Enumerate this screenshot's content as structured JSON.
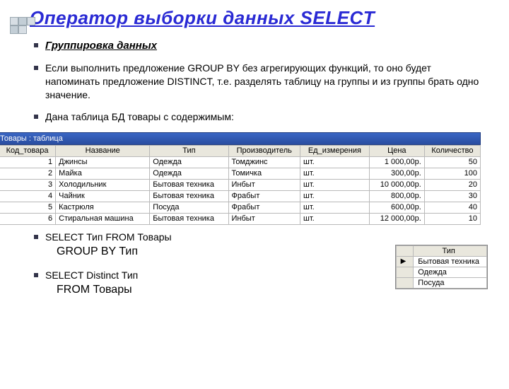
{
  "title": "Оператор выборки данных SELECT",
  "bullets": {
    "subhead": "Группировка данных",
    "p1": "Если выполнить предложение GROUP BY без агрегирующих функций, то оно будет напоминать предложение DISTINCT, т.е. разделять таблицу на группы и из группы брать одно значение.",
    "p2": "Дана таблица БД товары с содержимым:"
  },
  "mainTable": {
    "windowTitle": "Товары : таблица",
    "headers": [
      "Код_товара",
      "Название",
      "Тип",
      "Производитель",
      "Ед_измерения",
      "Цена",
      "Количество"
    ],
    "rows": [
      {
        "id": "1",
        "name": "Джинсы",
        "type": "Одежда",
        "maker": "Томджинс",
        "unit": "шт.",
        "price": "1 000,00р.",
        "qty": "50"
      },
      {
        "id": "2",
        "name": "Майка",
        "type": "Одежда",
        "maker": "Томичка",
        "unit": "шт.",
        "price": "300,00р.",
        "qty": "100"
      },
      {
        "id": "3",
        "name": "Холодильник",
        "type": "Бытовая техника",
        "maker": "Инбыт",
        "unit": "шт.",
        "price": "10 000,00р.",
        "qty": "20"
      },
      {
        "id": "4",
        "name": "Чайник",
        "type": "Бытовая техника",
        "maker": "Фрабыт",
        "unit": "шт.",
        "price": "800,00р.",
        "qty": "30"
      },
      {
        "id": "5",
        "name": "Кастрюля",
        "type": "Посуда",
        "maker": "Фрабыт",
        "unit": "шт.",
        "price": "600,00р.",
        "qty": "40"
      },
      {
        "id": "6",
        "name": "Стиральная машина",
        "type": "Бытовая техника",
        "maker": "Инбыт",
        "unit": "шт.",
        "price": "12 000,00р.",
        "qty": "10"
      }
    ]
  },
  "queries": {
    "q1a": "SELECT Тип FROM Товары",
    "q1b": "GROUP BY Тип",
    "q2a": "SELECT Distinct Тип",
    "q2b": "FROM Товары"
  },
  "resultTable": {
    "header": "Тип",
    "rows": [
      "Бытовая техника",
      "Одежда",
      "Посуда"
    ]
  }
}
